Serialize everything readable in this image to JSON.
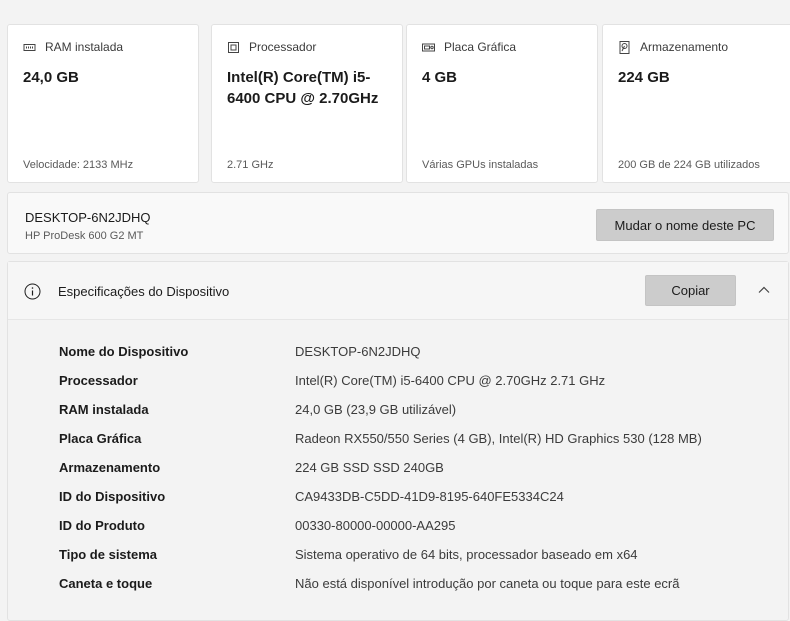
{
  "cards": [
    {
      "icon": "ram-icon",
      "label": "RAM instalada",
      "value": "24,0 GB",
      "sub": "Velocidade: 2133 MHz"
    },
    {
      "icon": "processor-icon",
      "label": "Processador",
      "value": "Intel(R) Core(TM) i5-6400 CPU @ 2.70GHz",
      "sub": "2.71 GHz"
    },
    {
      "icon": "graphics-card-icon",
      "label": "Placa Gráfica",
      "value": "4 GB",
      "sub": "Várias GPUs instaladas"
    },
    {
      "icon": "storage-icon",
      "label": "Armazenamento",
      "value": "224 GB",
      "sub": "200 GB de 224 GB utilizados"
    }
  ],
  "pc": {
    "name": "DESKTOP-6N2JDHQ",
    "model": "HP ProDesk 600 G2 MT",
    "rename_label": "Mudar o nome deste PC"
  },
  "specs": {
    "title": "Especificações do Dispositivo",
    "copy_label": "Copiar",
    "rows": [
      {
        "key": "Nome do Dispositivo",
        "value": "DESKTOP-6N2JDHQ"
      },
      {
        "key": "Processador",
        "value": "Intel(R) Core(TM) i5-6400 CPU @ 2.70GHz   2.71 GHz"
      },
      {
        "key": "RAM instalada",
        "value": "24,0 GB (23,9 GB utilizável)"
      },
      {
        "key": "Placa Gráfica",
        "value": "Radeon RX550/550 Series (4 GB), Intel(R) HD Graphics 530 (128 MB)"
      },
      {
        "key": "Armazenamento",
        "value": "224 GB SSD SSD 240GB"
      },
      {
        "key": "ID do Dispositivo",
        "value": "CA9433DB-C5DD-41D9-8195-640FE5334C24"
      },
      {
        "key": "ID do Produto",
        "value": "00330-80000-00000-AA295"
      },
      {
        "key": "Tipo de sistema",
        "value": "Sistema operativo de 64 bits, processador baseado em x64"
      },
      {
        "key": "Caneta e toque",
        "value": "Não está disponível introdução por caneta ou toque para este ecrã"
      }
    ]
  }
}
